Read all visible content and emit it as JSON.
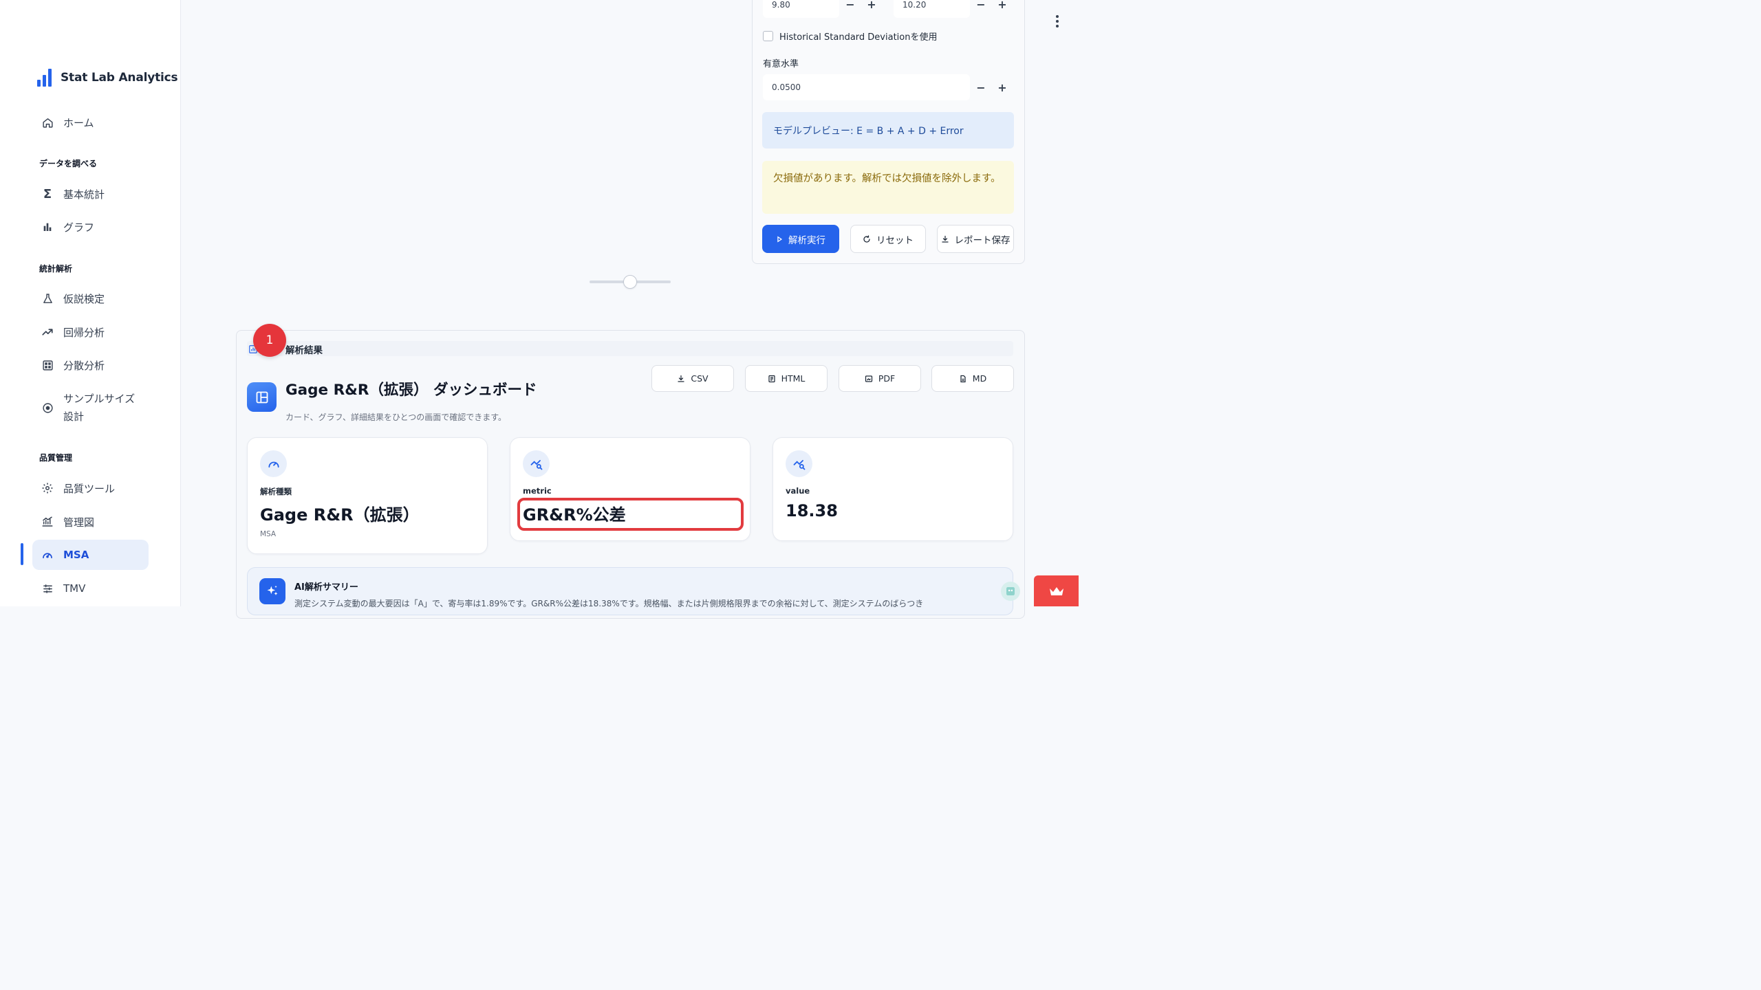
{
  "brand": {
    "name": "Stat Lab Analytics"
  },
  "sidebar": {
    "home": "ホーム",
    "sections": {
      "explore": "データを調べる",
      "analysis": "統計解析",
      "quality": "品質管理"
    },
    "items": {
      "basic_stats": "基本統計",
      "graph": "グラフ",
      "hypothesis": "仮説検定",
      "regression": "回帰分析",
      "anova": "分散分析",
      "sample_size_1": "サンプルサイズ",
      "sample_size_2": "設計",
      "quality_tools": "品質ツール",
      "control_chart": "管理図",
      "msa": "MSA",
      "tmv": "TMV"
    }
  },
  "settings": {
    "spec_lower": "9.80",
    "spec_upper": "10.20",
    "historical_sd_label": "Historical Standard Deviationを使用",
    "historical_sd_checked": false,
    "significance_label": "有意水準",
    "significance_value": "0.0500",
    "model_preview": "モデルプレビュー: E = B + A + D + Error",
    "missing_warning": "欠損値があります。解析では欠損値を除外します。",
    "run_button": "解析実行",
    "reset_button": "リセット",
    "save_button": "レポート保存"
  },
  "results": {
    "section_title": "解析結果",
    "badge_number": "1",
    "dashboard_title": "Gage R&R（拡張） ダッシュボード",
    "dashboard_subtitle": "カード、グラフ、詳細結果をひとつの画面で確認できます。",
    "export": {
      "csv": "CSV",
      "html": "HTML",
      "pdf": "PDF",
      "md": "MD"
    },
    "cards": [
      {
        "label": "解析種類",
        "value": "Gage R&R（拡張）",
        "sub": "MSA"
      },
      {
        "label": "metric",
        "value": "GR&R%公差",
        "sub": ""
      },
      {
        "label": "value",
        "value": "18.38",
        "sub": ""
      }
    ],
    "ai_summary_title": "AI解析サマリー",
    "ai_summary_text": "測定システム変動の最大要因は「A」で、寄与率は1.89%です。GR&R%公差は18.38%です。規格幅、または片側規格限界までの余裕に対して、測定システムのばらつき"
  },
  "colors": {
    "accent": "#2563eb",
    "highlight": "#e23b3f",
    "info_bg": "#e3edfb",
    "warn_bg": "#fbf9df"
  }
}
